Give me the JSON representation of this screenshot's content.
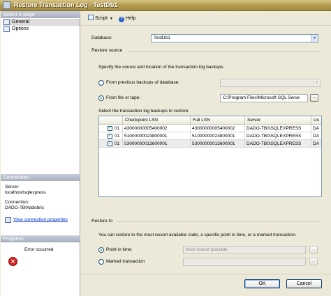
{
  "window": {
    "title": "Restore Transaction Log - TestDb1"
  },
  "left": {
    "select_page_header": "Select a page",
    "pages": [
      {
        "label": "General"
      },
      {
        "label": "Options"
      }
    ],
    "connection_header": "Connection",
    "server_label": "Server:",
    "server_value": "localhost\\sqlexpress",
    "connection_label": "Connection:",
    "connection_value": "DADO-TB0\\ddobric",
    "view_connection_link": "View connection properties",
    "progress_header": "Progress",
    "progress_status": "Error occurred"
  },
  "toolbar": {
    "script_label": "Script",
    "help_label": "Help"
  },
  "main": {
    "database_label": "Database:",
    "database_value": "TestDb1",
    "restore_source_header": "Restore source",
    "source_instruction": "Specify the source and location of the transaction log backups.",
    "from_previous_label": "From previous backups of database:",
    "from_previous_value": "",
    "from_file_label": "From file or tape:",
    "from_file_value": "C:\\Program Files\\Microsoft SQL Serve",
    "select_backups_label": "Select the transaction log backups to restore:",
    "grid_columns": [
      "",
      "Checkpoint LSN",
      "Full LSN",
      "Server",
      "Us"
    ],
    "grid_rows": [
      {
        "checked": true,
        "pos": "01",
        "checkpoint_lsn": "43000000005400002",
        "full_lsn": "43000000005400002",
        "server": "DADO-TB0\\SQLEXPRESS",
        "user": "DA"
      },
      {
        "checked": true,
        "pos": "01",
        "checkpoint_lsn": "51000000023800001",
        "full_lsn": "51000000023800001",
        "server": "DADO-TB0\\SQLEXPRESS",
        "user": "DA"
      },
      {
        "checked": true,
        "pos": "01",
        "checkpoint_lsn": "53000000013600001",
        "full_lsn": "53000000013600001",
        "server": "DADO-TB0\\SQLEXPRESS",
        "user": "DA"
      }
    ],
    "restore_to_header": "Restore to",
    "restore_to_instruction": "You can restore to the most recent available state, a specific point in time, or a marked transaction.",
    "point_in_time_label": "Point in time:",
    "point_in_time_value": "Most recent possible",
    "marked_transaction_label": "Marked transaction",
    "marked_transaction_value": ""
  },
  "buttons": {
    "ok_label": "OK",
    "cancel_label": "Cancel"
  }
}
